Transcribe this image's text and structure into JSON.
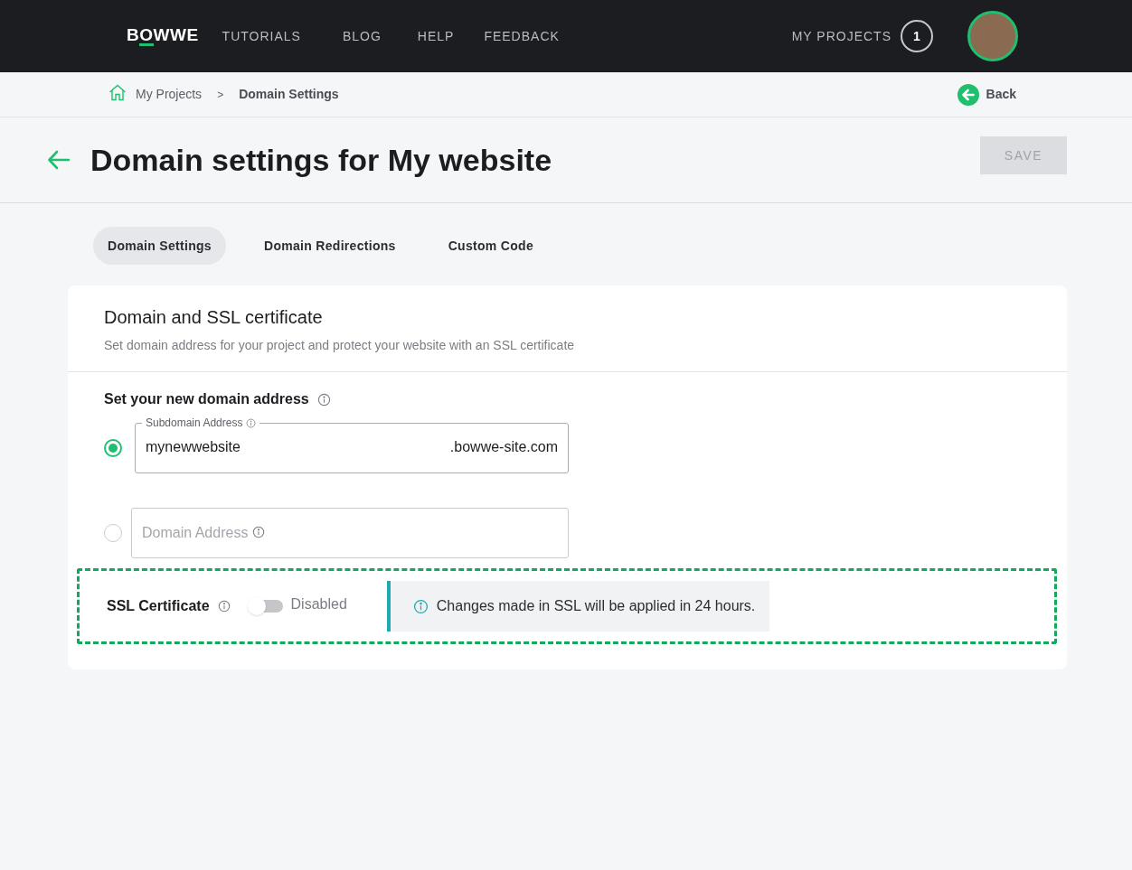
{
  "nav": {
    "logo": "BOWWE",
    "links": [
      "TUTORIALS",
      "BLOG",
      "HELP",
      "FEEDBACK"
    ],
    "projects_label": "MY PROJECTS",
    "projects_count": "1"
  },
  "breadcrumb": {
    "items": [
      "My Projects",
      "Domain Settings"
    ],
    "separator": ">",
    "back": "Back"
  },
  "header": {
    "title": "Domain settings for My website",
    "save": {
      "label": "SAVE",
      "disabled": true
    }
  },
  "tabs": [
    {
      "label": "Domain Settings",
      "selected": true
    },
    {
      "label": "Domain Redirections",
      "selected": false
    },
    {
      "label": "Custom Code",
      "selected": false
    }
  ],
  "card": {
    "title": "Domain and SSL certificate",
    "subtitle": "Set domain address for your project and protect your website with an SSL certificate",
    "section_label": "Set your new domain address",
    "options": [
      {
        "kind": "subdomain",
        "selected": true,
        "label": "Subdomain Address",
        "value": "mynewwebsite",
        "suffix": ".bowwe-site.com"
      },
      {
        "kind": "domain",
        "selected": false,
        "placeholder": "Domain Address"
      }
    ],
    "ssl": {
      "label": "SSL Certificate",
      "on": false,
      "state_text": "Disabled",
      "notice": "Changes made in SSL will be applied in 24 hours.",
      "highlighted": true
    }
  }
}
